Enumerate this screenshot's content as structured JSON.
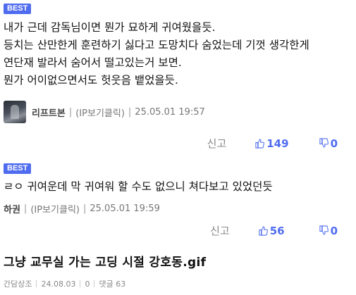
{
  "comments": [
    {
      "badge": "BEST",
      "lines": [
        "내가 근데 감독님이면 뭔가 묘하게 귀여웠을듯.",
        "등치는 산만한게 훈련하기 싫다고 도망치다 숨었는데 기껏 생각한게",
        "연단재 발라서 숨어서 떨고있는거 보면.",
        "뭔가 어이없으면서도 헛웃음 뱉었을듯."
      ],
      "nickname": "리프트본",
      "ip": "(IP보기클릭)",
      "timestamp": "25.05.01 19:57",
      "report_label": "신고",
      "likes": "149",
      "dislikes": "0",
      "has_avatar": true
    },
    {
      "badge": "BEST",
      "lines": [
        "ㄹㅇ 귀여운데 막 귀여워 할 수도 없으니 쳐다보고 있었던듯"
      ],
      "nickname": "하권",
      "ip": "(IP보기클릭)",
      "timestamp": "25.05.01 19:59",
      "report_label": "신고",
      "likes": "56",
      "dislikes": "0",
      "has_avatar": false
    }
  ],
  "post": {
    "title": "그냥 교무실 가는 고딩 시절 강호동.gif",
    "author": "간담상조",
    "date": "24.08.03",
    "views": "0",
    "comment_label": "댓글 63"
  },
  "colors": {
    "accent": "#4f6cf0",
    "badge": "#4f6cf0",
    "muted": "#888888"
  },
  "icons": {
    "like": "thumbs-up-icon",
    "dislike": "thumbs-down-icon"
  }
}
